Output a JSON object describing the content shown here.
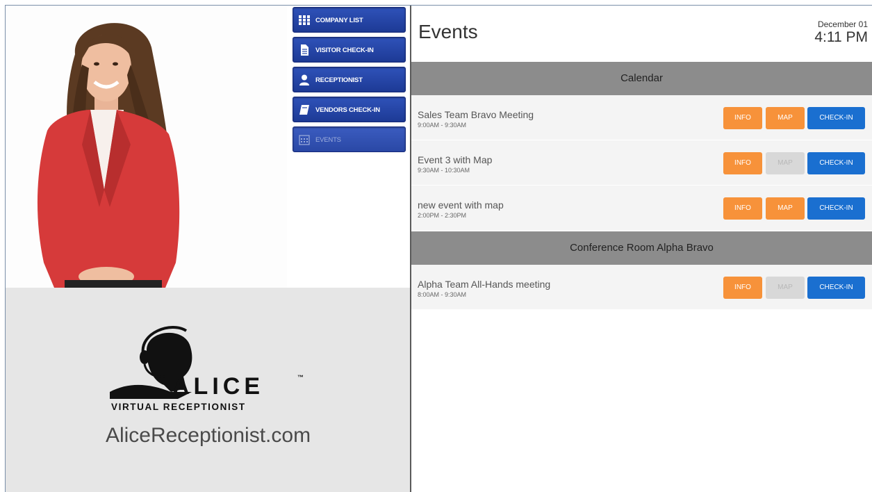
{
  "menu": [
    {
      "label": "COMPANY LIST",
      "icon": "grid-icon",
      "enabled": true
    },
    {
      "label": "VISITOR CHECK-IN",
      "icon": "document-icon",
      "enabled": true
    },
    {
      "label": "RECEPTIONIST",
      "icon": "person-icon",
      "enabled": true
    },
    {
      "label": "VENDORS CHECK-IN",
      "icon": "book-icon",
      "enabled": true
    },
    {
      "label": "EVENTS",
      "icon": "calendar-icon",
      "enabled": false
    }
  ],
  "brand": {
    "logo_word": "ALICE",
    "tm": "™",
    "tagline": "VIRTUAL RECEPTIONIST",
    "url": "AliceReceptionist.com"
  },
  "header": {
    "title": "Events",
    "date": "December 01",
    "time": "4:11 PM"
  },
  "buttons": {
    "info": "INFO",
    "map": "MAP",
    "checkin": "CHECK-IN"
  },
  "sections": [
    {
      "name": "Calendar",
      "events": [
        {
          "name": "Sales Team Bravo Meeting",
          "time": "9:00AM - 9:30AM",
          "map_enabled": true
        },
        {
          "name": "Event 3 with Map",
          "time": "9:30AM - 10:30AM",
          "map_enabled": false
        },
        {
          "name": "new event with map",
          "time": "2:00PM - 2:30PM",
          "map_enabled": true
        }
      ]
    },
    {
      "name": "Conference Room Alpha Bravo",
      "events": [
        {
          "name": "Alpha Team All-Hands meeting",
          "time": "8:00AM - 9:30AM",
          "map_enabled": false
        }
      ]
    }
  ],
  "colors": {
    "menu_blue": "#2546a8",
    "orange": "#f7923a",
    "checkin_blue": "#1a6fd0",
    "section_gray": "#8c8c8c",
    "disabled_gray": "#d8d8d8"
  }
}
